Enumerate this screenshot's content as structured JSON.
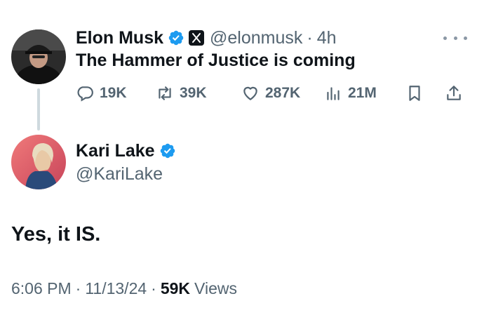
{
  "original_tweet": {
    "author_name": "Elon Musk",
    "handle": "@elonmusk",
    "time": "4h",
    "text": "The Hammer of Justice is coming",
    "replies": "19K",
    "retweets": "39K",
    "likes": "287K",
    "views": "21M"
  },
  "reply_tweet": {
    "author_name": "Kari Lake",
    "handle": "@KariLake",
    "text": "Yes, it IS.",
    "time": "6:06 PM",
    "date": "11/13/24",
    "views_count": "59K",
    "views_label": "Views"
  },
  "icons": {
    "verified": "verified-badge-icon",
    "affiliate": "x-logo-icon",
    "more": "more-icon",
    "reply": "reply-icon",
    "retweet": "retweet-icon",
    "like": "heart-icon",
    "views": "analytics-icon",
    "bookmark": "bookmark-icon",
    "share": "share-icon"
  },
  "colors": {
    "text": "#0f1419",
    "muted": "#536471",
    "verified_blue": "#1d9bf0",
    "thread_line": "#cfd9de"
  }
}
